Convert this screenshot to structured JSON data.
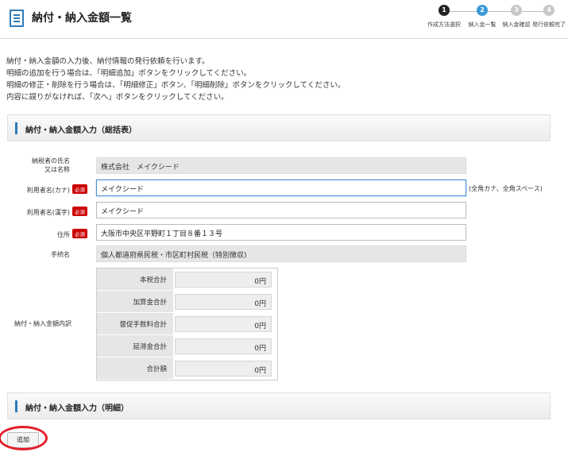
{
  "page": {
    "title": "納付・納入金額一覧"
  },
  "steps": [
    {
      "num": "1",
      "label": "作成方法選択",
      "state": "done",
      "color": "#222222"
    },
    {
      "num": "2",
      "label": "納入金一覧",
      "state": "current",
      "color": "#3a9ad9"
    },
    {
      "num": "3",
      "label": "納入金確認",
      "state": "todo",
      "color": "#c8c8c8"
    },
    {
      "num": "4",
      "label": "発行依頼完了",
      "state": "todo",
      "color": "#c8c8c8"
    }
  ],
  "intro": {
    "line1": "納付・納入金額の入力後、納付情報の発行依頼を行います。",
    "line2": "明細の追加を行う場合は、「明細追加」ボタンをクリックしてください。",
    "line3": "明細の修正・削除を行う場合は、「明細修正」ボタン、「明細削除」ボタンをクリックしてください。",
    "line4": "内容に誤りがなければ、「次へ」ボタンをクリックしてください。"
  },
  "section1": {
    "title": "納付・納入金額入力（総括表）"
  },
  "section2": {
    "title": "納付・納入金額入力（明細）"
  },
  "form": {
    "taxpayer_label_1": "納税者の氏名",
    "taxpayer_label_2": "又は名称",
    "taxpayer_value": "株式会社　メイクシード",
    "kana_label": "利用者名(カナ)",
    "kana_value": "メイクシード",
    "kana_hint": "(全角カナ、全角スペース)",
    "kanji_label": "利用者名(漢字)",
    "kanji_value": "メイクシード",
    "address_label": "住所",
    "address_value": "大阪市中央区平野町１丁目８番１３号",
    "procedure_label": "手続名",
    "procedure_value": "個人都道府県民税・市区町村民税（特別徴収)",
    "breakdown_label": "納付・納入金額内訳",
    "required_badge": "必須"
  },
  "breakdown": [
    {
      "label": "本税合計",
      "value": "0円"
    },
    {
      "label": "加算金合計",
      "value": "0円"
    },
    {
      "label": "督促手数料合計",
      "value": "0円"
    },
    {
      "label": "延滞金合計",
      "value": "0円"
    },
    {
      "label": "合計額",
      "value": "0円"
    }
  ],
  "buttons": {
    "add": "追加"
  },
  "colors": {
    "accent": "#2e7bb8",
    "required": "#cc0000",
    "highlight": "#e0202a"
  }
}
